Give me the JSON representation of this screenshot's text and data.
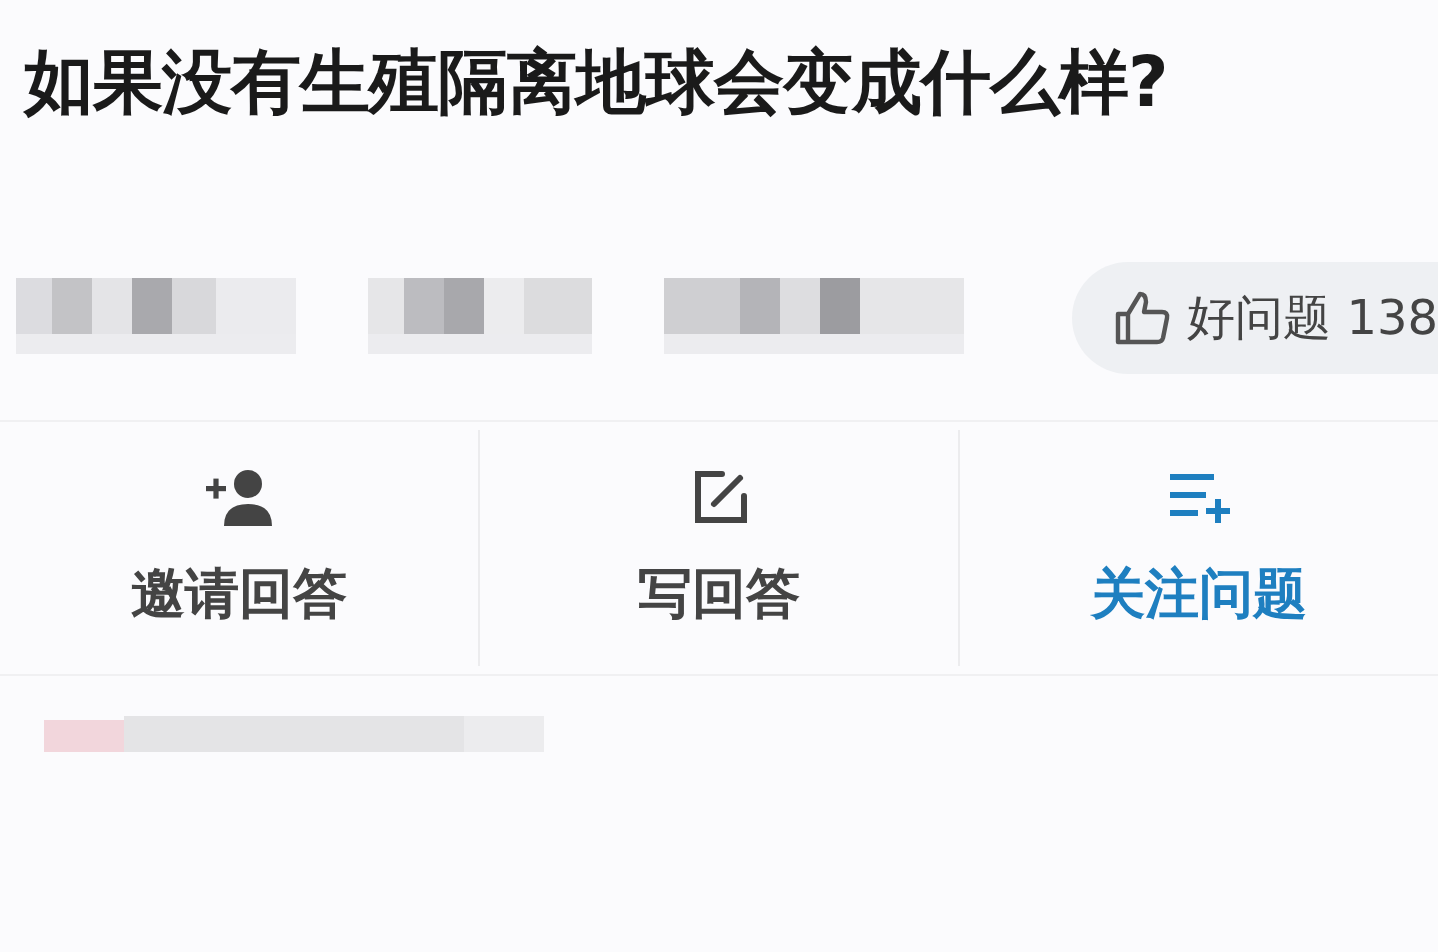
{
  "question": {
    "title": "如果没有生殖隔离地球会变成什么样?"
  },
  "vote": {
    "label": "好问题 138"
  },
  "actions": [
    {
      "kind": "invite",
      "label": "邀请回答",
      "color": "#444444"
    },
    {
      "kind": "write",
      "label": "写回答",
      "color": "#444444"
    },
    {
      "kind": "follow",
      "label": "关注问题",
      "color": "#1e7fc0"
    }
  ]
}
